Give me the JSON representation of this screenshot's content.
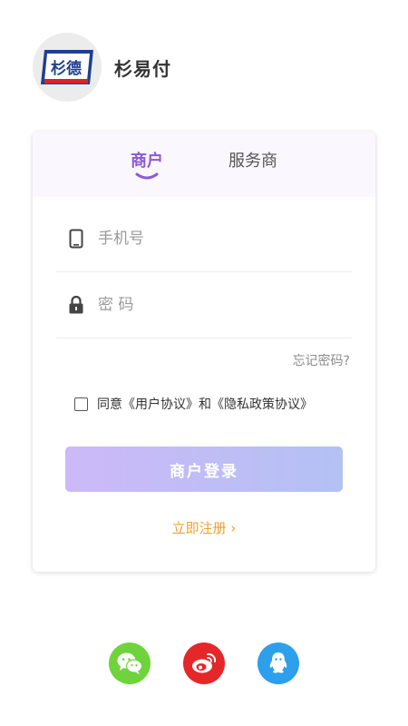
{
  "app": {
    "name": "杉易付",
    "logo_text": "杉德"
  },
  "tabs": [
    {
      "label": "商户",
      "active": true
    },
    {
      "label": "服务商",
      "active": false
    }
  ],
  "form": {
    "phone_placeholder": "手机号",
    "phone_value": "",
    "password_placeholder": "密 码",
    "password_value": "",
    "forgot_label": "忘记密码?",
    "agreement_text": "同意《用户协议》和《隐私政策协议》",
    "agreement_checked": false,
    "login_label": "商户登录",
    "register_label": "立即注册 ›"
  },
  "social": [
    {
      "icon": "wechat-icon",
      "color": "#6fd33c"
    },
    {
      "icon": "weibo-icon",
      "color": "#e5272a"
    },
    {
      "icon": "qq-icon",
      "color": "#2d9fec"
    }
  ],
  "colors": {
    "accent": "#8a5ad8",
    "register": "#f0a030",
    "button_gradient_start": "#cdb9f8",
    "button_gradient_end": "#b3c1f3"
  }
}
